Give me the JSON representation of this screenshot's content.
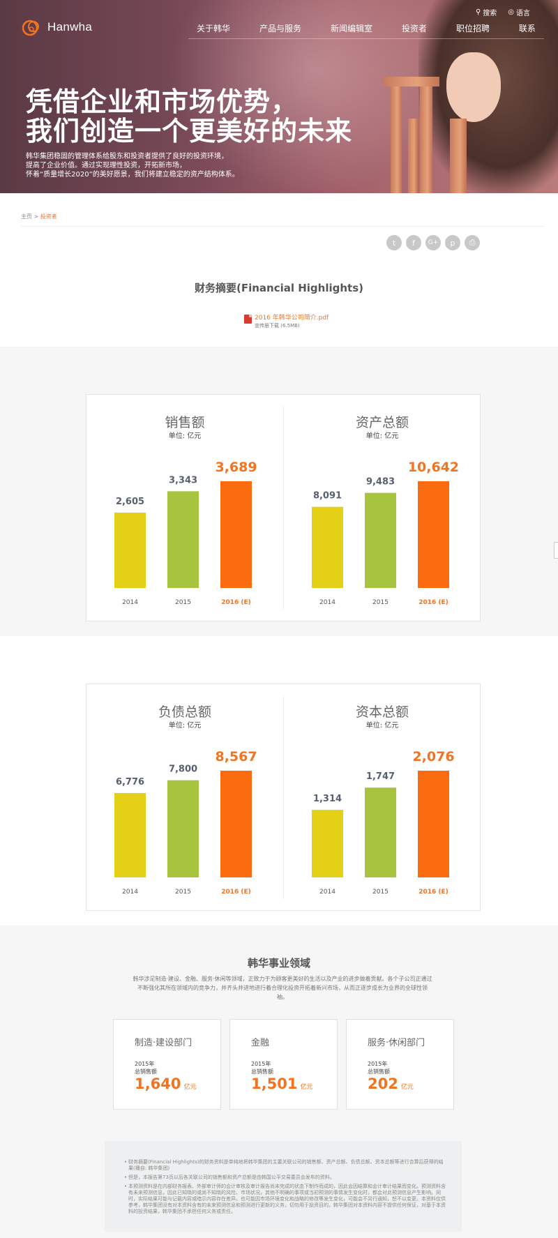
{
  "header": {
    "logo_text": "Hanwha",
    "util": {
      "search": "搜索",
      "language": "语言"
    },
    "nav": [
      "关于韩华",
      "产品与服务",
      "新闻编辑室",
      "投资者",
      "职位招聘",
      "联系"
    ]
  },
  "hero": {
    "title_line1": "凭借企业和市场优势，",
    "title_line2": "我们创造一个更美好的未来",
    "desc_line1": "韩华集团稳固的管理体系给股东和投资者提供了良好的投资环境，",
    "desc_line2": "提高了企业价值。通过实现理性投资，开拓新市场，",
    "desc_line3": "怀着“质量增长2020”的美好愿景，我们将建立稳定的资产结构体系。"
  },
  "breadcrumb": {
    "home": "主页",
    "sep": " > ",
    "current": "投资者"
  },
  "social": [
    "twitter-icon",
    "facebook-icon",
    "google-plus-icon",
    "pinterest-icon",
    "print-icon"
  ],
  "financial": {
    "title": "财务摘要(Financial Highlights)",
    "pdf_name": "2016 年韩华公司简介.pdf",
    "pdf_sub": "宣传册下载 (6.5MB)"
  },
  "colors": {
    "accent": "#f37321",
    "y2014": "#e5d018",
    "y2015": "#a8c43e",
    "y2016": "#fb6c10"
  },
  "chart_data": [
    {
      "type": "bar",
      "title": "销售额",
      "unit": "单位: 亿元",
      "categories": [
        "2014",
        "2015",
        "2016 (E)"
      ],
      "values": [
        2605,
        3343,
        3689
      ],
      "labels": [
        "2,605",
        "3,343",
        "3,689"
      ]
    },
    {
      "type": "bar",
      "title": "资产总额",
      "unit": "单位: 亿元",
      "categories": [
        "2014",
        "2015",
        "2016 (E)"
      ],
      "values": [
        8091,
        9483,
        10642
      ],
      "labels": [
        "8,091",
        "9,483",
        "10,642"
      ]
    },
    {
      "type": "bar",
      "title": "负债总额",
      "unit": "单位: 亿元",
      "categories": [
        "2014",
        "2015",
        "2016 (E)"
      ],
      "values": [
        6776,
        7800,
        8567
      ],
      "labels": [
        "6,776",
        "7,800",
        "8,567"
      ]
    },
    {
      "type": "bar",
      "title": "资本总额",
      "unit": "单位: 亿元",
      "categories": [
        "2014",
        "2015",
        "2016 (E)"
      ],
      "values": [
        1314,
        1747,
        2076
      ],
      "labels": [
        "1,314",
        "1,747",
        "2,076"
      ]
    }
  ],
  "business": {
    "title": "韩华事业领域",
    "desc": "韩华涉足制造·建设、金融、服务·休闲等领域，正致力于为顾客更美好的生活以及产业的进步做着贡献。各个子公司正通过不断强化其所在领域内的竞争力，并齐头并进地进行着合理化投资开拓着新兴市场，从而正逐步成长为业界的全球性领袖。",
    "boxes": [
      {
        "name": "制造·建设部门",
        "year": "2015年",
        "label": "总销售额",
        "value": "1,640",
        "unit": "亿元"
      },
      {
        "name": "金融",
        "year": "2015年",
        "label": "总销售额",
        "value": "1,501",
        "unit": "亿元"
      },
      {
        "name": "服务·休闲部门",
        "year": "2015年",
        "label": "总销售额",
        "value": "202",
        "unit": "亿元"
      }
    ]
  },
  "notes": [
    "财务摘要(Financial Highlights)的财务资料是单纯地将韩华集团的主要关联公司的销售额、资产总额、负债总额、资本总额等进行合算后获得的结果(播自: 韩华集团)",
    "但是，本报告第73页以后各关联公司的销售额和资产总额是由韩国公平交易委员会发布的资料。",
    "本预测资料是在内部财务报表、外部审计师的会计审核及审计报告尚未完成的状态下制作而成的，因此会因结算和会计审计结果而变化。预测资料含有未来预测信息，因此已知晓的或尚不知晓的风险、市场状况，其他不明确的事项或当初预测的事情发生变化时，都会对此预测信息产生影响。同时，实际结果可能与记载内容或暗示内容存在差异。也可能因市场环境变化和战略的修改等发生变化，可能会不另行通知，恕不以变更。本资料仅供参考，韩华集团没有对本资料含有的未来预测信息和预测进行更新的义务，切勿用于投资目的。韩华集团对本资料内容不提供任何保证，对基于本资料的投资结果，韩华集团不承担任何义务或责任。"
  ]
}
